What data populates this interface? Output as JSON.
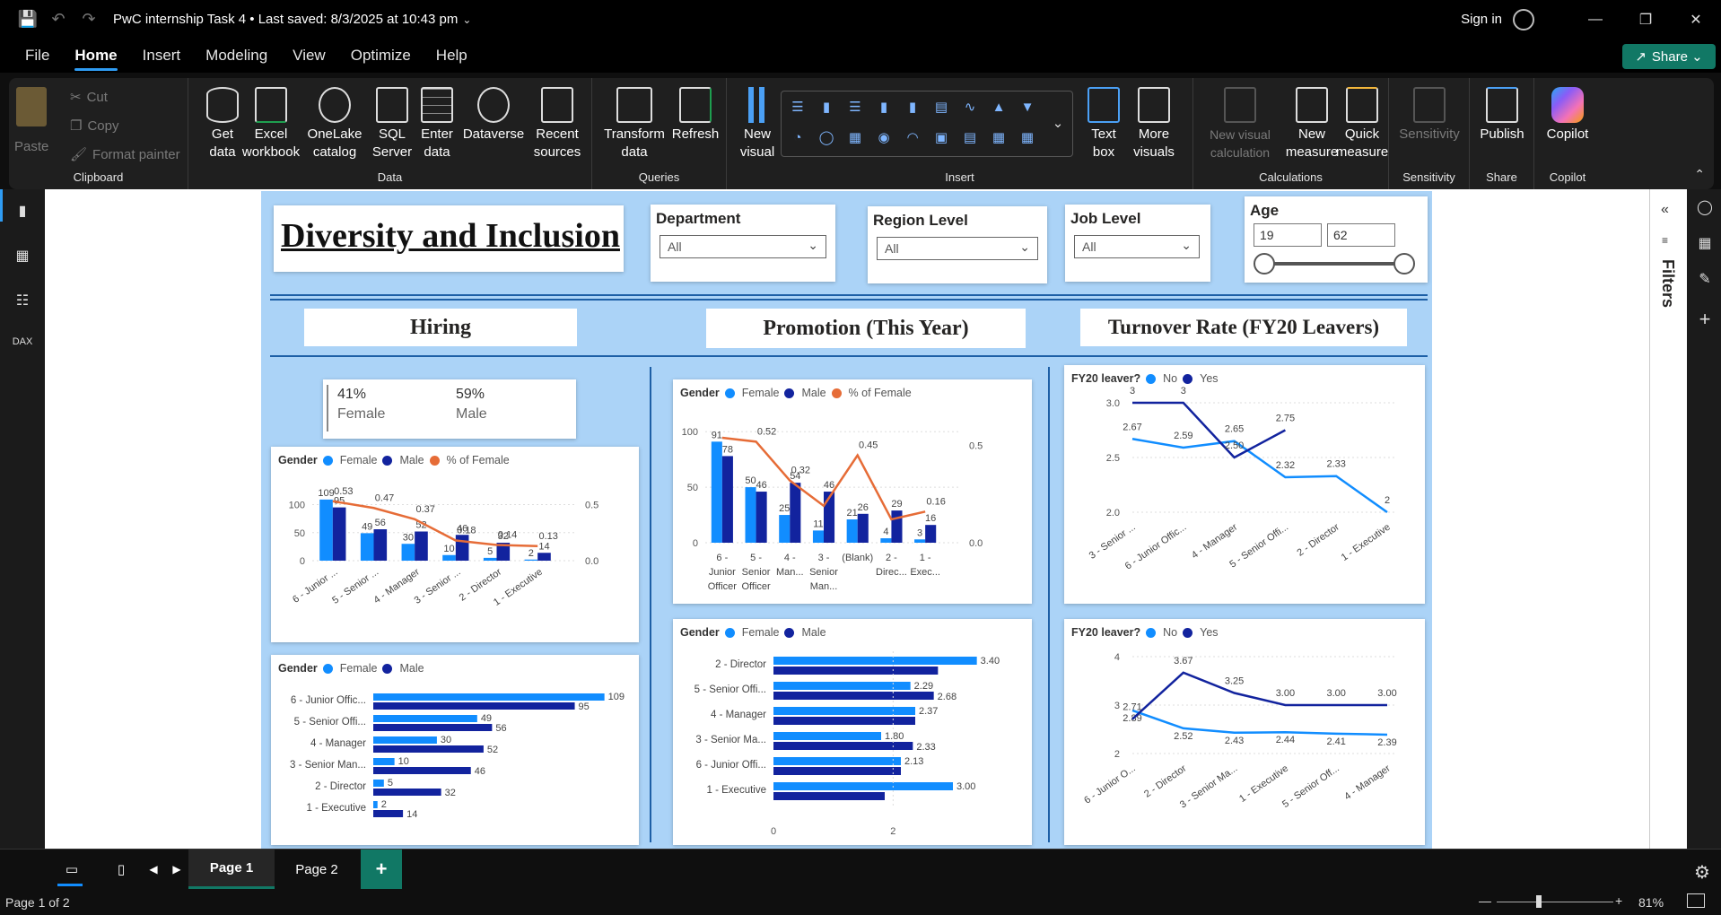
{
  "app": {
    "title": "PwC internship Task 4 • Last saved: 8/3/2025 at 10:43 pm",
    "sign_in": "Sign in",
    "share": "Share"
  },
  "menu": [
    "File",
    "Home",
    "Insert",
    "Modeling",
    "View",
    "Optimize",
    "Help"
  ],
  "ribbon": {
    "clipboard": {
      "paste": "Paste",
      "cut": "Cut",
      "copy": "Copy",
      "format_painter": "Format painter",
      "label": "Clipboard"
    },
    "data": {
      "get_data": "Get data",
      "excel": "Excel workbook",
      "onelake": "OneLake catalog",
      "sql": "SQL Server",
      "enter": "Enter data",
      "dataverse": "Dataverse",
      "recent": "Recent sources",
      "label": "Data"
    },
    "queries": {
      "transform": "Transform data",
      "refresh": "Refresh",
      "label": "Queries"
    },
    "insert": {
      "new_visual": "New visual",
      "text_box": "Text box",
      "more_visuals": "More visuals",
      "label": "Insert"
    },
    "calculations": {
      "new_visual_calc": "New visual calculation",
      "new_measure": "New measure",
      "quick_measure": "Quick measure",
      "label": "Calculations"
    },
    "sensitivity": {
      "btn": "Sensitivity",
      "label": "Sensitivity"
    },
    "share": {
      "publish": "Publish",
      "label": "Share"
    },
    "copilot": {
      "btn": "Copilot",
      "label": "Copilot"
    }
  },
  "report": {
    "title": "Diversity and Inclusion",
    "slicers": {
      "department": {
        "title": "Department",
        "value": "All"
      },
      "region": {
        "title": "Region Level",
        "value": "All"
      },
      "job": {
        "title": "Job Level",
        "value": "All"
      },
      "age": {
        "title": "Age",
        "min": "19",
        "max": "62"
      }
    },
    "sections": {
      "hiring": "Hiring",
      "promotion": "Promotion (This Year)",
      "turnover": "Turnover Rate (FY20 Leavers)"
    },
    "kpi": {
      "female_pct": "41%",
      "female_label": "Female",
      "male_pct": "59%",
      "male_label": "Male"
    },
    "legend": {
      "gender": "Gender",
      "female": "Female",
      "male": "Male",
      "pct_female": "% of Female",
      "fy20": "FY20 leaver?",
      "no": "No",
      "yes": "Yes"
    }
  },
  "colors": {
    "female": "#118dff",
    "male": "#12239e",
    "pct": "#e66c37",
    "report_bg": "#abd3f7"
  },
  "chart_data": [
    {
      "type": "bar",
      "id": "hiring_combo",
      "categories": [
        "6 - Junior ...",
        "5 - Senior ...",
        "4 - Manager",
        "3 - Senior ...",
        "2 - Director",
        "1 - Executive"
      ],
      "series": [
        {
          "name": "Female",
          "values": [
            109,
            49,
            30,
            10,
            5,
            2
          ]
        },
        {
          "name": "Male",
          "values": [
            95,
            56,
            52,
            46,
            32,
            14
          ]
        },
        {
          "name": "% of Female",
          "values": [
            0.53,
            0.47,
            0.37,
            0.18,
            0.14,
            0.13
          ]
        }
      ],
      "y_ticks": [
        "0",
        "50",
        "100"
      ],
      "y2_ticks": [
        "0.0",
        "0.5"
      ],
      "ylim": [
        0,
        120
      ],
      "y2lim": [
        0,
        0.6
      ]
    },
    {
      "type": "bar",
      "id": "hiring_hbar",
      "orientation": "horizontal",
      "categories": [
        "6 - Junior Offic...",
        "5 - Senior Offi...",
        "4 - Manager",
        "3 - Senior Man...",
        "2 - Director",
        "1 - Executive"
      ],
      "series": [
        {
          "name": "Female",
          "values": [
            109,
            49,
            30,
            10,
            5,
            2
          ]
        },
        {
          "name": "Male",
          "values": [
            95,
            56,
            52,
            46,
            32,
            14
          ]
        }
      ],
      "xlim": [
        0,
        110
      ]
    },
    {
      "type": "bar",
      "id": "promotion_combo",
      "categories": [
        "6 - Junior Officer",
        "5 - Senior Officer",
        "4 - Man...",
        "3 - Senior Man...",
        "(Blank)",
        "2 - Direc...",
        "1 - Exec..."
      ],
      "series": [
        {
          "name": "Female",
          "values": [
            91,
            50,
            25,
            11,
            21,
            4,
            3
          ]
        },
        {
          "name": "Male",
          "values": [
            78,
            46,
            54,
            46,
            26,
            29,
            16
          ]
        },
        {
          "name": "% of Female",
          "values": [
            0.54,
            0.52,
            0.32,
            0.19,
            0.45,
            0.12,
            0.16
          ]
        }
      ],
      "labels": {
        "pct": [
          "",
          "0.52",
          "0.32",
          "",
          "0.45",
          "",
          "0.16"
        ]
      },
      "y_ticks": [
        "0",
        "50",
        "100"
      ],
      "y2_ticks": [
        "0.0",
        "0.5"
      ],
      "ylim": [
        0,
        105
      ],
      "y2lim": [
        0,
        0.6
      ]
    },
    {
      "type": "bar",
      "id": "promotion_hbar",
      "orientation": "horizontal",
      "categories": [
        "2 - Director",
        "5 - Senior Offi...",
        "4 - Manager",
        "3 - Senior Ma...",
        "6 - Junior Offi...",
        "1 - Executive"
      ],
      "series": [
        {
          "name": "Female",
          "values": [
            3.4,
            2.29,
            2.37,
            1.8,
            2.13,
            3.0
          ]
        },
        {
          "name": "Male",
          "values": [
            2.75,
            2.68,
            2.37,
            2.33,
            2.13,
            1.86
          ]
        }
      ],
      "female_labels": [
        "3.40",
        "2.29",
        "2.37",
        "1.80",
        "2.13",
        "3.00"
      ],
      "male_labels": [
        "",
        "2.68",
        "",
        "2.33",
        "",
        ""
      ],
      "x_ticks": [
        "0",
        "2"
      ],
      "xlim": [
        0,
        3.6
      ]
    },
    {
      "type": "line",
      "id": "turnover_line_1",
      "categories": [
        "3 - Senior ...",
        "6 - Junior Offic...",
        "4 - Manager",
        "5 - Senior Offi...",
        "2 - Director",
        "1 - Executive"
      ],
      "series": [
        {
          "name": "No",
          "values": [
            2.67,
            2.59,
            2.65,
            2.32,
            2.33,
            2.0
          ]
        },
        {
          "name": "Yes",
          "values": [
            3.0,
            3.0,
            2.5,
            2.75,
            null,
            null
          ]
        }
      ],
      "y_ticks": [
        "2.0",
        "2.5",
        "3.0"
      ],
      "ylim": [
        2.0,
        3.0
      ]
    },
    {
      "type": "line",
      "id": "turnover_line_2",
      "categories": [
        "6 - Junior O...",
        "2 - Director",
        "3 - Senior Ma...",
        "1 - Executive",
        "5 - Senior Off...",
        "4 - Manager"
      ],
      "series": [
        {
          "name": "No",
          "values": [
            2.89,
            2.52,
            2.43,
            2.44,
            2.41,
            2.39
          ]
        },
        {
          "name": "Yes",
          "values": [
            2.71,
            3.67,
            3.25,
            3.0,
            3.0,
            3.0
          ]
        }
      ],
      "yes_labels": [
        "2.71",
        "3.67",
        "3.25",
        "3.00",
        "3.00",
        "3.00"
      ],
      "y_ticks": [
        "2",
        "3",
        "4"
      ],
      "ylim": [
        2,
        4
      ]
    }
  ],
  "pages": {
    "page1": "Page 1",
    "page2": "Page 2"
  },
  "status": {
    "page_info": "Page 1 of 2",
    "zoom": "81%"
  },
  "panes": {
    "filters": "Filters"
  }
}
